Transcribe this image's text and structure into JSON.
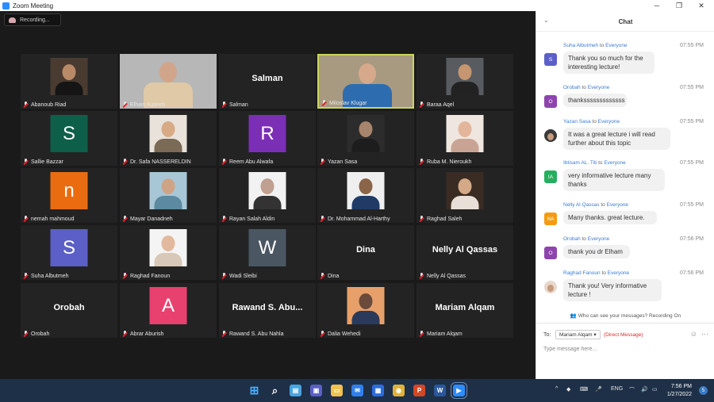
{
  "window": {
    "title": "Zoom Meeting",
    "minimize": "─",
    "restore": "❐",
    "close": "✕"
  },
  "recording": {
    "label": "Recording..."
  },
  "tiles": [
    {
      "name": "Abanoub Riad",
      "kind": "photo",
      "bg": "#4a3b30",
      "face": "#b88a68",
      "shirt": "#151515"
    },
    {
      "name": "Elham Kateeb",
      "kind": "photo",
      "bg": "#b7b7b7",
      "face": "#d1a58a",
      "shirt": "#e0c9a6"
    },
    {
      "name": "Salman",
      "kind": "text",
      "label": "Salman"
    },
    {
      "name": "Miloslav Klugar",
      "kind": "photo",
      "bg": "#a89a80",
      "face": "#d6a98c",
      "shirt": "#2e6cb0",
      "active": true
    },
    {
      "name": "Baraa Aqel",
      "kind": "photo",
      "bg": "#585c60",
      "face": "#c5966f",
      "shirt": "#222"
    },
    {
      "name": "Sallie Bazzar",
      "kind": "avatar",
      "letter": "S",
      "color": "#0e5f4a"
    },
    {
      "name": "Dr. Safa NASSERELDIN",
      "kind": "photo",
      "bg": "#e8e2da",
      "face": "#d9aa86",
      "shirt": "#7a6a56"
    },
    {
      "name": "Reem Abu Alwafa",
      "kind": "avatar",
      "letter": "R",
      "color": "#7a2fb5"
    },
    {
      "name": "Yazan Sasa",
      "kind": "photo",
      "bg": "#2c2c2c",
      "face": "#a7856c",
      "shirt": "#1d1d1d"
    },
    {
      "name": "Ruba M. Nieroukh",
      "kind": "photo",
      "bg": "#f0e6e0",
      "face": "#e3b69b",
      "shirt": "#c9a494"
    },
    {
      "name": "nemah mahmoud",
      "kind": "avatar",
      "letter": "n",
      "color": "#ea6c10"
    },
    {
      "name": "Mayar Danadneh",
      "kind": "photo",
      "bg": "#a8c7d6",
      "face": "#cfa486",
      "shirt": "#5c8aa0"
    },
    {
      "name": "Rayan Salah Aldin",
      "kind": "photo",
      "bg": "#f2f2f2",
      "face": "#c0a090",
      "shirt": "#333"
    },
    {
      "name": "Dr. Mohammad Al-Harthy",
      "kind": "photo",
      "bg": "#efefef",
      "face": "#8a6548",
      "shirt": "#1f3b66"
    },
    {
      "name": "Raghad Saleh",
      "kind": "photo",
      "bg": "#3a2c22",
      "face": "#d4a987",
      "shirt": "#e8e0d8"
    },
    {
      "name": "Suha Albutmeh",
      "kind": "avatar",
      "letter": "S",
      "color": "#5b5fc7"
    },
    {
      "name": "Raghad Fanoun",
      "kind": "photo",
      "bg": "#f4f4f4",
      "face": "#e2b99d",
      "shirt": "#d8c8b8"
    },
    {
      "name": "Wadi Sleibi",
      "kind": "avatar",
      "letter": "W",
      "color": "#4a5763"
    },
    {
      "name": "Dina",
      "kind": "text",
      "label": "Dina"
    },
    {
      "name": "Nelly Al Qassas",
      "kind": "text",
      "label": "Nelly Al Qassas"
    },
    {
      "name": "Orobah",
      "kind": "text",
      "label": "Orobah"
    },
    {
      "name": "Abrar Aburish",
      "kind": "avatar",
      "letter": "A",
      "color": "#e8416f"
    },
    {
      "name": "Rawand S. Abu Nahla",
      "kind": "text",
      "label": "Rawand S. Abu..."
    },
    {
      "name": "Dalia Wehedi",
      "kind": "photo",
      "bg": "#e7a06a",
      "face": "#6a4a3a",
      "shirt": "#2a3a5a"
    },
    {
      "name": "Mariam Alqam",
      "kind": "text",
      "label": "Mariam Alqam"
    }
  ],
  "chat": {
    "title": "Chat",
    "to_word": "to",
    "messages": [
      {
        "sender": "Suha Albutmeh",
        "to": "Everyone",
        "time": "07:55 PM",
        "text": "Thank you so much for the interesting lecture!",
        "avatar": "S",
        "avatar_color": "#5b5fc7"
      },
      {
        "sender": "Orobah",
        "to": "Everyone",
        "time": "07:55 PM",
        "text": "thanksssssssssssss",
        "avatar": "O",
        "avatar_color": "#8e44ad"
      },
      {
        "sender": "Yazan Sasa",
        "to": "Everyone",
        "time": "07:55 PM",
        "text": "It was a great lecture i will read further about this topic",
        "avatar": "",
        "avatar_color": "#3a3a3a"
      },
      {
        "sender": "Ibtisam AL. Titi",
        "to": "Everyone",
        "time": "07:55 PM",
        "text": "very informative lecture many thanks",
        "avatar": "IA",
        "avatar_color": "#27ae60"
      },
      {
        "sender": "Nelly Al Qassas",
        "to": "Everyone",
        "time": "07:55 PM",
        "text": "Many thanks. great lecture.",
        "avatar": "NA",
        "avatar_color": "#f39c12"
      },
      {
        "sender": "Orobah",
        "to": "Everyone",
        "time": "07:56 PM",
        "text": "thank you dr Elham",
        "avatar": "O",
        "avatar_color": "#8e44ad"
      },
      {
        "sender": "Raghad Fanoun",
        "to": "Everyone",
        "time": "07:56 PM",
        "text": "Thank you! Very informative lecture !",
        "avatar": "",
        "avatar_color": "#e8d8cc"
      }
    ],
    "who_can_see": "Who can see your messages? Recording On",
    "to_label": "To:",
    "recipient": "Mariam Alqam",
    "direct": "(Direct Message)",
    "placeholder": "Type message here..."
  },
  "taskbar": {
    "lang": "ENG",
    "time": "7:56 PM",
    "date": "1/27/2022",
    "notify_count": "5",
    "apps": [
      {
        "name": "start-icon",
        "color": "#3aa0f0"
      },
      {
        "name": "search-icon",
        "color": "#1e3047"
      },
      {
        "name": "widgets-icon",
        "color": "#4aa3df"
      },
      {
        "name": "teams-icon",
        "color": "#5b5fc7"
      },
      {
        "name": "file-explorer-icon",
        "color": "#f2c14e"
      },
      {
        "name": "mail-icon",
        "color": "#2f80ed"
      },
      {
        "name": "store-icon",
        "color": "#2d6cdf"
      },
      {
        "name": "chrome-icon",
        "color": "#e0b23a"
      },
      {
        "name": "powerpoint-icon",
        "color": "#d24726"
      },
      {
        "name": "word-icon",
        "color": "#2b579a"
      },
      {
        "name": "zoom-icon",
        "color": "#2d8cff"
      }
    ]
  }
}
